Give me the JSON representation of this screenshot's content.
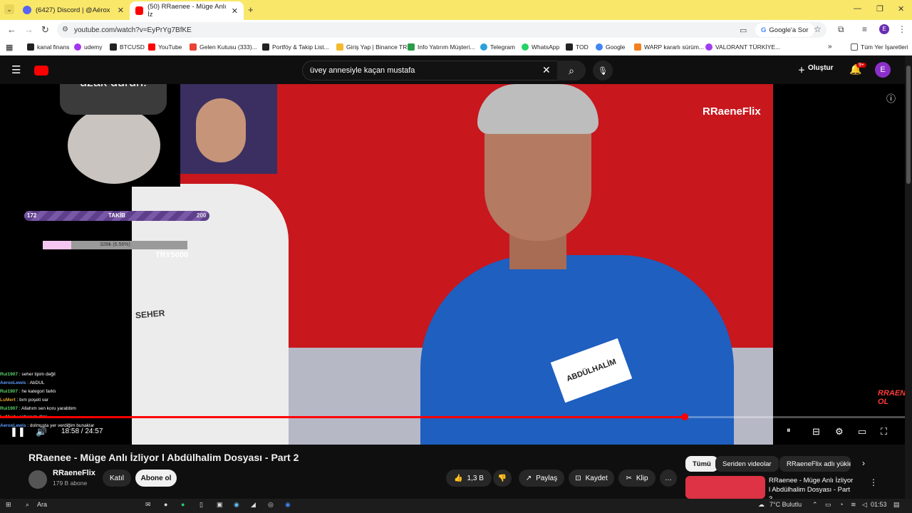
{
  "tabs": [
    {
      "label": "(6427) Discord | @Aérox",
      "color": "#5865f2"
    },
    {
      "label": "(50) RRaenee - Müge Anlı İz",
      "color": "#ff0000"
    }
  ],
  "address": {
    "url": "youtube.com/watch?v=EyPrYg7BfKE",
    "google_label": "Google'a Sor"
  },
  "bookmarks": [
    "kanal finans",
    "udemy",
    "BTCUSD",
    "YouTube",
    "Gelen Kutusu (333)...",
    "Portföy & Takip List...",
    "Giriş Yap | Binance TR",
    "Info Yatırım Müşteri...",
    "Telegram",
    "WhatsApp",
    "TOD",
    "Google",
    "WARP kararlı sürüm...",
    "VALORANT TÜRKİYE...",
    "Tüm Yer İşaretleri"
  ],
  "youtube": {
    "search_value": "üvey annesiyle kaçan mustafa",
    "create_label": "Oluştur",
    "notif_count": "9+",
    "avatar_letter": "E"
  },
  "video": {
    "brand_watermark": "RRaeneFlix",
    "bubble_text": "Çorumluyuz amk uzak durun.",
    "follow_goal": {
      "current": "172",
      "label": "TAKİB",
      "target": "200"
    },
    "donation": {
      "label": "328₺ (6.56%)",
      "goal": "TRY5000",
      "progress": 0.0656
    },
    "seher_label": "SEHER",
    "badge_label": "ABDÜLHALİM",
    "corner_logo": "RRAENE OL",
    "progress": 0.757,
    "time": "18:58 / 24:57",
    "chat": [
      {
        "user": "Rui1907",
        "msg": "seher tipim değil",
        "color": "#5bd36a"
      },
      {
        "user": "AeroxLewis",
        "msg": "AbDUL",
        "color": "#5c9cff"
      },
      {
        "user": "Rui1907",
        "msg": "he kategori farklı",
        "color": "#5bd36a"
      },
      {
        "user": "LuMert",
        "msg": "bım poşeti var",
        "color": "#e0a030"
      },
      {
        "user": "Rui1907",
        "msg": "Allahım sen koru yarabbim",
        "color": "#5bd36a"
      },
      {
        "user": "LuMert",
        "msg": "seherum dimi",
        "color": "#e0a030"
      },
      {
        "user": "AeroxLewis",
        "msg": "dolmuşta yer verdiğim bunaklar",
        "color": "#5c9cff"
      }
    ]
  },
  "meta": {
    "title": "RRaenee - Müge Anlı İzliyor l Abdülhalim Dosyası - Part 2",
    "channel": "RRaeneFlix",
    "subscribers": "179 B abone",
    "join_label": "Katıl",
    "subscribe_label": "Abone ol",
    "likes": "1,3 B",
    "share_label": "Paylaş",
    "save_label": "Kaydet",
    "clip_label": "Klip"
  },
  "chips": [
    "Tümü",
    "Seriden videolar",
    "RRaeneFlix adlı yükle"
  ],
  "recommended": {
    "title": "RRaenee - Müge Anlı İzliyor l Abdülhalim Dosyası - Part 3"
  },
  "taskbar": {
    "search": "Ara",
    "weather": "7°C  Bulutlu",
    "clock": "01:53"
  }
}
